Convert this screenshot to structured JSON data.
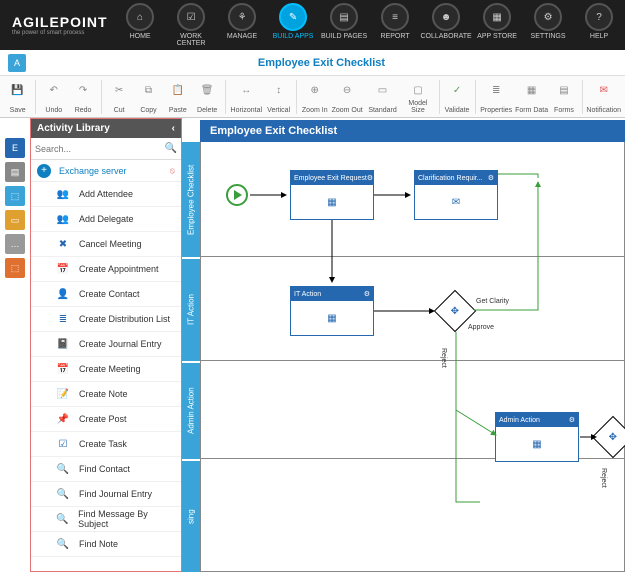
{
  "brand": {
    "name": "AGILEPOINT",
    "tag": "the power of smart process"
  },
  "nav": [
    {
      "id": "home",
      "label": "HOME",
      "icon": "⌂"
    },
    {
      "id": "workcenter",
      "label": "WORK CENTER",
      "icon": "☑"
    },
    {
      "id": "manage",
      "label": "MANAGE",
      "icon": "⚘"
    },
    {
      "id": "buildapps",
      "label": "BUILD APPS",
      "icon": "✎",
      "active": true
    },
    {
      "id": "buildpages",
      "label": "BUILD PAGES",
      "icon": "▤"
    },
    {
      "id": "report",
      "label": "REPORT",
      "icon": "≡"
    },
    {
      "id": "collaborate",
      "label": "COLLABORATE",
      "icon": "☻"
    },
    {
      "id": "appstore",
      "label": "APP STORE",
      "icon": "▦"
    },
    {
      "id": "settings",
      "label": "SETTINGS",
      "icon": "⚙"
    },
    {
      "id": "help",
      "label": "HELP",
      "icon": "?"
    }
  ],
  "page_title": "Employee Exit Checklist",
  "toolbar": [
    {
      "id": "save",
      "label": "Save",
      "icon": "💾",
      "cls": ""
    },
    {
      "sep": true
    },
    {
      "id": "undo",
      "label": "Undo",
      "icon": "↶"
    },
    {
      "id": "redo",
      "label": "Redo",
      "icon": "↷"
    },
    {
      "sep": true
    },
    {
      "id": "cut",
      "label": "Cut",
      "icon": "✂"
    },
    {
      "id": "copy",
      "label": "Copy",
      "icon": "⧉"
    },
    {
      "id": "paste",
      "label": "Paste",
      "icon": "📋"
    },
    {
      "id": "delete",
      "label": "Delete",
      "icon": "🗑"
    },
    {
      "sep": true
    },
    {
      "id": "horizontal",
      "label": "Horizontal",
      "icon": "↔",
      "cls": "w"
    },
    {
      "id": "vertical",
      "label": "Vertical",
      "icon": "↕"
    },
    {
      "sep": true
    },
    {
      "id": "zoomin",
      "label": "Zoom In",
      "icon": "⊕"
    },
    {
      "id": "zoomout",
      "label": "Zoom Out",
      "icon": "⊖",
      "cls": "w"
    },
    {
      "id": "standard",
      "label": "Standard",
      "icon": "▭",
      "cls": "w"
    },
    {
      "id": "modelsize",
      "label": "Model Size",
      "icon": "▢",
      "cls": "w"
    },
    {
      "sep": true
    },
    {
      "id": "validate",
      "label": "Validate",
      "icon": "✓",
      "cls": "grn"
    },
    {
      "sep": true
    },
    {
      "id": "properties",
      "label": "Properties",
      "icon": "≣",
      "cls": "w"
    },
    {
      "id": "formdata",
      "label": "Form Data",
      "icon": "▦",
      "cls": "w"
    },
    {
      "id": "forms",
      "label": "Forms",
      "icon": "▤"
    },
    {
      "sep": true
    },
    {
      "id": "notification",
      "label": "Notification",
      "icon": "✉",
      "cls": "w red"
    }
  ],
  "library": {
    "title": "Activity Library",
    "search_ph": "Search...",
    "category": "Exchange server",
    "items": [
      {
        "label": "Add Attendee",
        "icon": "👥"
      },
      {
        "label": "Add Delegate",
        "icon": "👥"
      },
      {
        "label": "Cancel Meeting",
        "icon": "✖"
      },
      {
        "label": "Create Appointment",
        "icon": "📅"
      },
      {
        "label": "Create Contact",
        "icon": "👤"
      },
      {
        "label": "Create Distribution List",
        "icon": "≣"
      },
      {
        "label": "Create Journal Entry",
        "icon": "📓"
      },
      {
        "label": "Create Meeting",
        "icon": "📅"
      },
      {
        "label": "Create Note",
        "icon": "📝"
      },
      {
        "label": "Create Post",
        "icon": "📌"
      },
      {
        "label": "Create Task",
        "icon": "☑"
      },
      {
        "label": "Find Contact",
        "icon": "🔍"
      },
      {
        "label": "Find Journal Entry",
        "icon": "🔍"
      },
      {
        "label": "Find Message By Subject",
        "icon": "🔍"
      },
      {
        "label": "Find Note",
        "icon": "🔍"
      }
    ]
  },
  "leftbar": [
    {
      "id": "a1",
      "color": "#2668b0",
      "icon": "E"
    },
    {
      "id": "a2",
      "color": "#888",
      "icon": "▤"
    },
    {
      "id": "a3",
      "color": "#3aa4d9",
      "icon": "⬚"
    },
    {
      "id": "a4",
      "color": "#e0a030",
      "icon": "▭"
    },
    {
      "id": "a5",
      "color": "#999",
      "icon": "…"
    },
    {
      "id": "a6",
      "color": "#e07030",
      "icon": "⬚"
    }
  ],
  "process": {
    "title": "Employee Exit Checklist",
    "lanes": [
      "Employee Checklist",
      "IT Action",
      "Admin Action",
      "sing"
    ],
    "activities": {
      "a1": {
        "title": "Employee Exit Request",
        "icon": "▦"
      },
      "a2": {
        "title": "Clarification Requir...",
        "icon": "✉"
      },
      "a3": {
        "title": "IT Action",
        "icon": "▦"
      },
      "a4": {
        "title": "Admin Action",
        "icon": "▦"
      }
    },
    "labels": {
      "getclarity": "Get Clarity",
      "approve": "Approve",
      "reject": "Reject"
    }
  }
}
